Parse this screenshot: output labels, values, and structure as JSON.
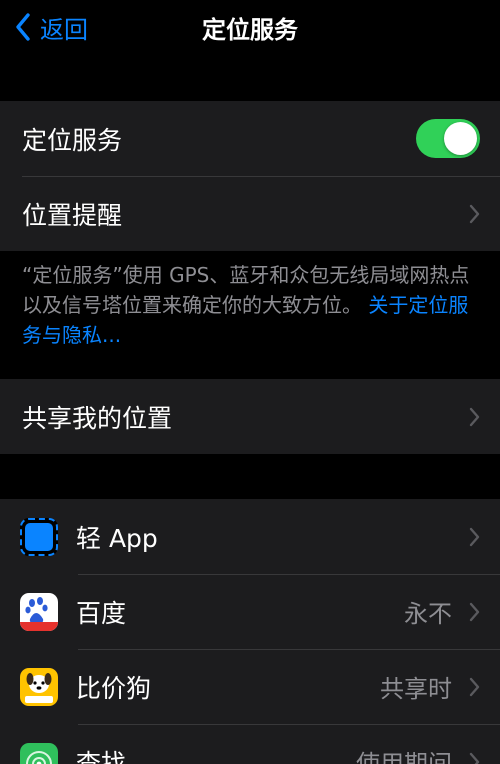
{
  "nav": {
    "back_label": "返回",
    "title": "定位服务"
  },
  "main_group": {
    "location_services_label": "定位服务",
    "location_services_on": true,
    "location_reminders_label": "位置提醒"
  },
  "footer": {
    "text": "“定位服务”使用 GPS、蓝牙和众包无线局域网热点以及信号塔位置来确定你的大致方位。",
    "link": "关于定位服务与隐私..."
  },
  "share_group": {
    "label": "共享我的位置"
  },
  "apps": [
    {
      "name": "轻 App",
      "value": "",
      "icon": "light-app-icon"
    },
    {
      "name": "百度",
      "value": "永不",
      "icon": "baidu-icon"
    },
    {
      "name": "比价狗",
      "value": "共享时",
      "icon": "bijiagou-icon"
    },
    {
      "name": "查找",
      "value": "使用期间",
      "icon": "find-my-icon"
    }
  ],
  "colors": {
    "accent": "#0a84ff",
    "toggle_on": "#30d158",
    "cell_background": "#1c1c1e",
    "secondary_text": "#8e8e93"
  }
}
